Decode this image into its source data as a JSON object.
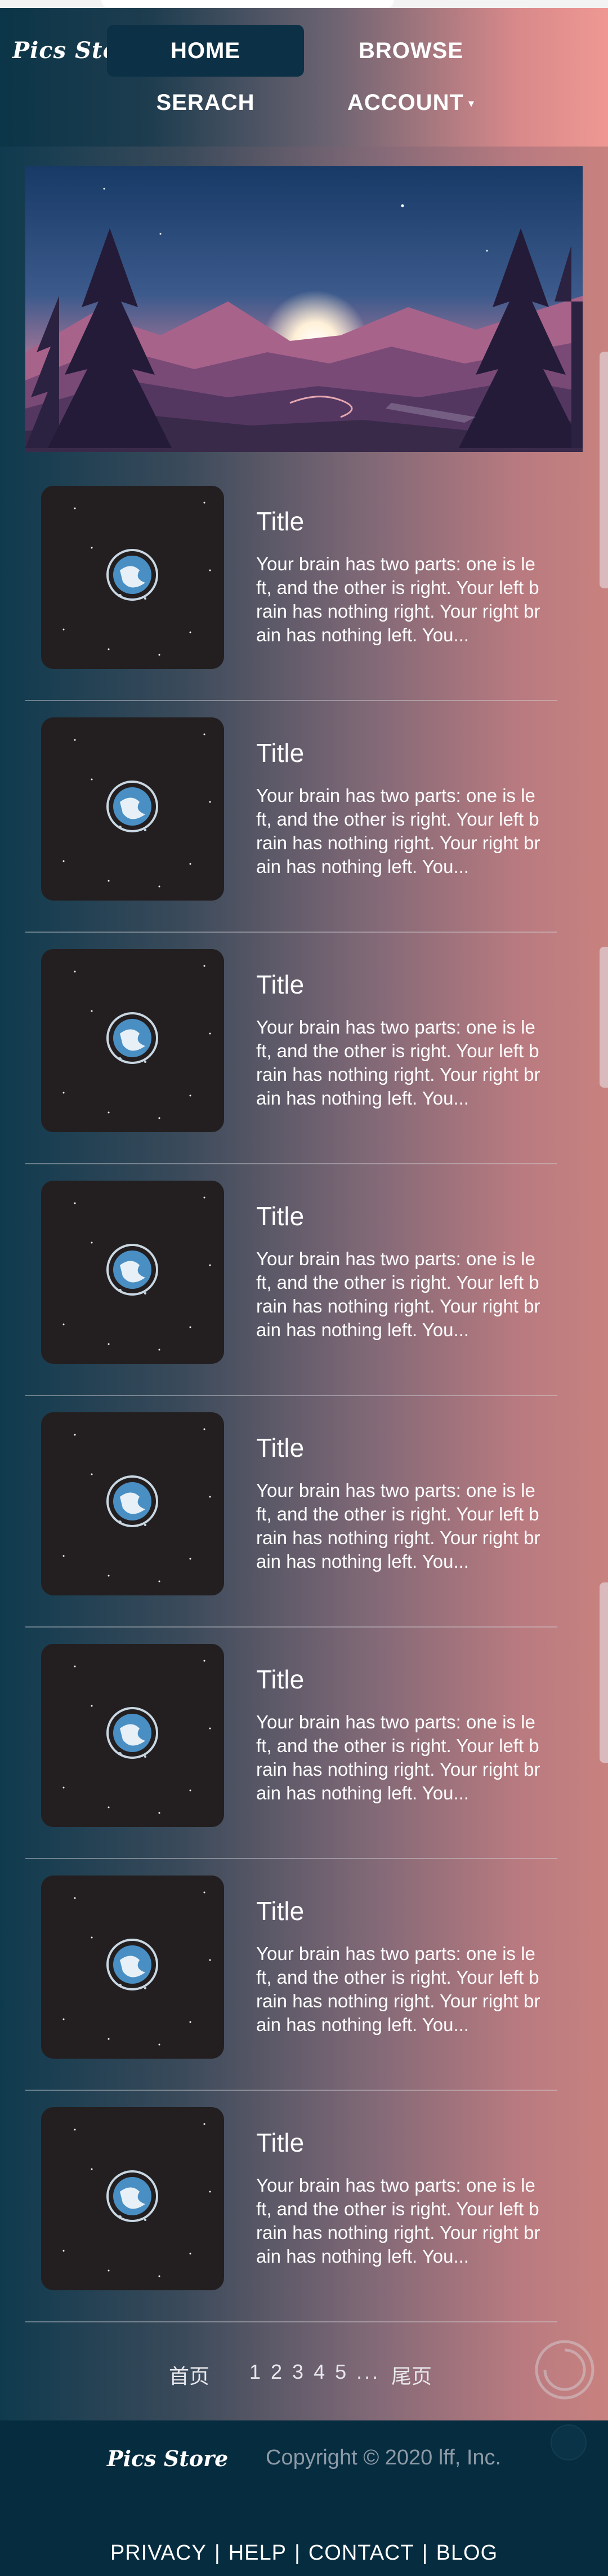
{
  "header": {
    "logo": "Pics Store",
    "nav": {
      "home": "HOME",
      "browse": "BROWSE",
      "search": "SERACH",
      "account": "ACCOUNT",
      "account_caret": "▾"
    }
  },
  "cards": [
    {
      "title": "Title",
      "desc": "Your brain has two parts: one is left, and the other is right. Your left brain has nothing right. Your right brain has nothing left. You..."
    },
    {
      "title": "Title",
      "desc": "Your brain has two parts: one is left, and the other is right. Your left brain has nothing right. Your right brain has nothing left. You..."
    },
    {
      "title": "Title",
      "desc": "Your brain has two parts: one is left, and the other is right. Your left brain has nothing right. Your right brain has nothing left. You..."
    },
    {
      "title": "Title",
      "desc": "Your brain has two parts: one is left, and the other is right. Your left brain has nothing right. Your right brain has nothing left. You..."
    },
    {
      "title": "Title",
      "desc": "Your brain has two parts: one is left, and the other is right. Your left brain has nothing right. Your right brain has nothing left. You..."
    },
    {
      "title": "Title",
      "desc": "Your brain has two parts: one is left, and the other is right. Your left brain has nothing right. Your right brain has nothing left. You..."
    },
    {
      "title": "Title",
      "desc": "Your brain has two parts: one is left, and the other is right. Your left brain has nothing right. Your right brain has nothing left. You..."
    },
    {
      "title": "Title",
      "desc": "Your brain has two parts: one is left, and the other is right. Your left brain has nothing right. Your right brain has nothing left. You..."
    }
  ],
  "pagination": {
    "first": "首页",
    "pages": "1 2 3 4 5 ...",
    "last": "尾页"
  },
  "footer": {
    "logo": "Pics Store",
    "copyright": "Copyright © 2020 lff, Inc.",
    "links": [
      "PRIVACY",
      "HELP",
      "CONTACT",
      "BLOG"
    ],
    "separator": "|"
  },
  "colors": {
    "nav_active": "#0c3146",
    "footer_bg": "#062c40",
    "thumb_bg": "#231f20",
    "planet": "#4a8fc4"
  },
  "icons": {
    "hero": "mountain-landscape-illustration",
    "thumb": "planet-in-space-illustration",
    "loader": "loading-spinner-icon"
  }
}
